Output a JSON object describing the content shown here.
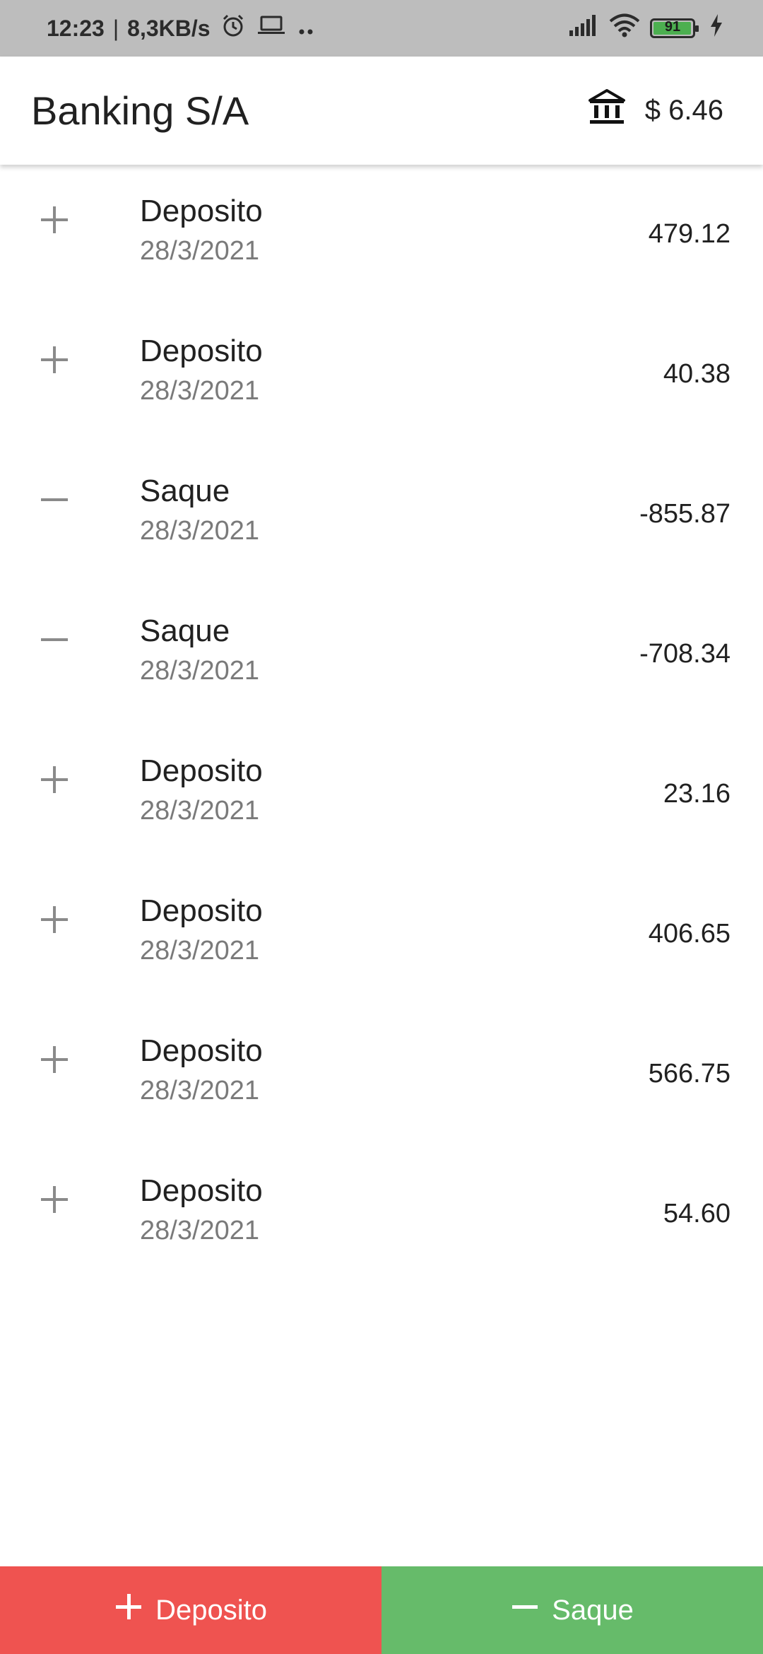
{
  "status_bar": {
    "time": "12:23",
    "separator": "|",
    "network_speed": "8,3KB/s",
    "icons": [
      "alarm-icon",
      "laptop-icon",
      "more-dots-icon",
      "signal-icon",
      "wifi-icon",
      "battery-icon",
      "charging-icon"
    ],
    "battery_level": "91"
  },
  "app_bar": {
    "title": "Banking S/A",
    "balance_icon": "bank-icon",
    "balance": "$ 6.46"
  },
  "transactions": [
    {
      "type": "deposit",
      "icon": "plus-icon",
      "label": "Deposito",
      "date": "28/3/2021",
      "amount": "479.12"
    },
    {
      "type": "deposit",
      "icon": "plus-icon",
      "label": "Deposito",
      "date": "28/3/2021",
      "amount": "40.38"
    },
    {
      "type": "withdraw",
      "icon": "minus-icon",
      "label": "Saque",
      "date": "28/3/2021",
      "amount": "-855.87"
    },
    {
      "type": "withdraw",
      "icon": "minus-icon",
      "label": "Saque",
      "date": "28/3/2021",
      "amount": "-708.34"
    },
    {
      "type": "deposit",
      "icon": "plus-icon",
      "label": "Deposito",
      "date": "28/3/2021",
      "amount": "23.16"
    },
    {
      "type": "deposit",
      "icon": "plus-icon",
      "label": "Deposito",
      "date": "28/3/2021",
      "amount": "406.65"
    },
    {
      "type": "deposit",
      "icon": "plus-icon",
      "label": "Deposito",
      "date": "28/3/2021",
      "amount": "566.75"
    },
    {
      "type": "deposit",
      "icon": "plus-icon",
      "label": "Deposito",
      "date": "28/3/2021",
      "amount": "54.60"
    }
  ],
  "bottom_actions": {
    "deposit_label": "Deposito",
    "withdraw_label": "Saque"
  },
  "colors": {
    "status_bar_bg": "#bdbdbd",
    "deposit_button": "#ef5350",
    "withdraw_button": "#66bb6a",
    "row_icon": "#8a8a8a",
    "date_text": "#7a7a7a",
    "battery_fill": "#4caf50"
  }
}
